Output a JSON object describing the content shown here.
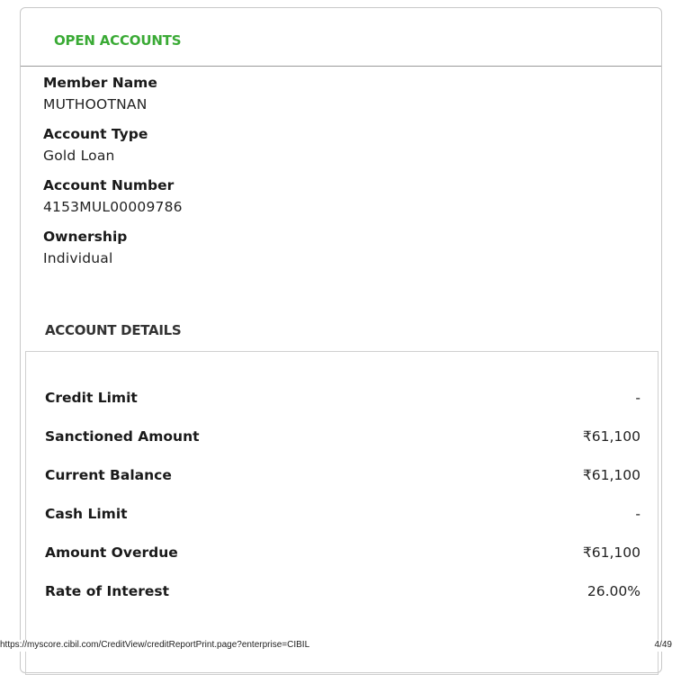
{
  "section": {
    "title": "OPEN ACCOUNTS"
  },
  "fields": [
    {
      "label": "Member Name",
      "value": "MUTHOOTNAN"
    },
    {
      "label": "Account Type",
      "value": "Gold Loan"
    },
    {
      "label": "Account Number",
      "value": "4153MUL00009786"
    },
    {
      "label": "Ownership",
      "value": "Individual"
    }
  ],
  "details": {
    "title": "ACCOUNT DETAILS",
    "rows": [
      {
        "label": "Credit Limit",
        "value": "-"
      },
      {
        "label": "Sanctioned Amount",
        "value": "₹61,100"
      },
      {
        "label": "Current Balance",
        "value": "₹61,100"
      },
      {
        "label": "Cash Limit",
        "value": "-"
      },
      {
        "label": "Amount Overdue",
        "value": "₹61,100"
      },
      {
        "label": "Rate of Interest",
        "value": "26.00%"
      }
    ]
  },
  "footer": {
    "url": "https://myscore.cibil.com/CreditView/creditReportPrint.page?enterprise=CIBIL",
    "page": "4/49"
  },
  "colors": {
    "accent": "#3aaa35"
  }
}
